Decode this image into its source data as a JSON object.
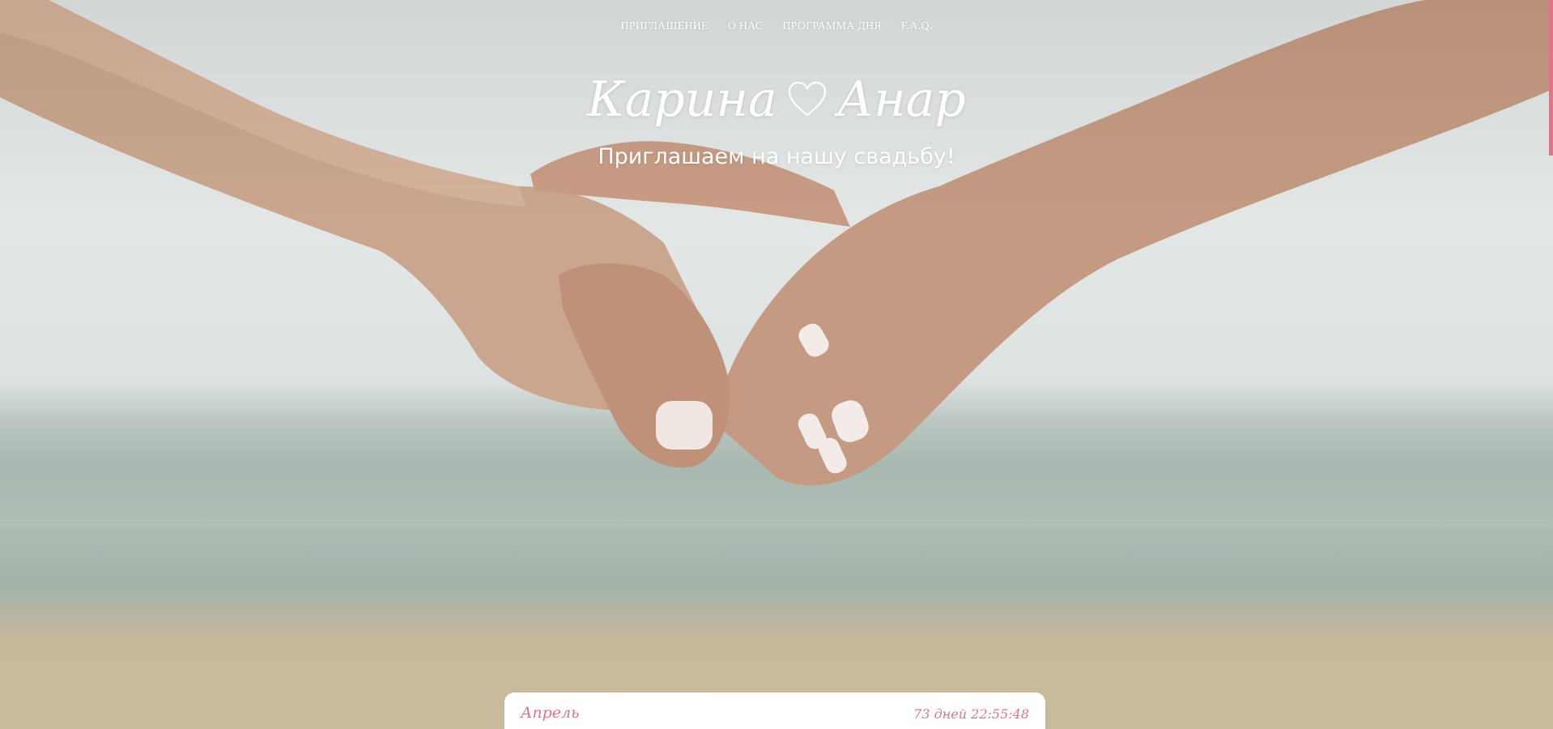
{
  "nav": {
    "items": [
      {
        "label": "ПРИГЛАШЕНИЕ"
      },
      {
        "label": "О НАС"
      },
      {
        "label": "ПРОГРАММА ДНЯ"
      },
      {
        "label": "F.A.Q."
      }
    ]
  },
  "hero": {
    "bride": "Карина",
    "groom": "Анар",
    "separator_icon": "heart-outline-icon",
    "subtitle": "Приглашаем на нашу свадьбу!"
  },
  "countdown": {
    "month": "Апрель",
    "timer": "73 дней 22:55:48"
  },
  "colors": {
    "accent": "#e0748a",
    "text_light": "#ffffff",
    "card_bg": "#ffffff"
  }
}
